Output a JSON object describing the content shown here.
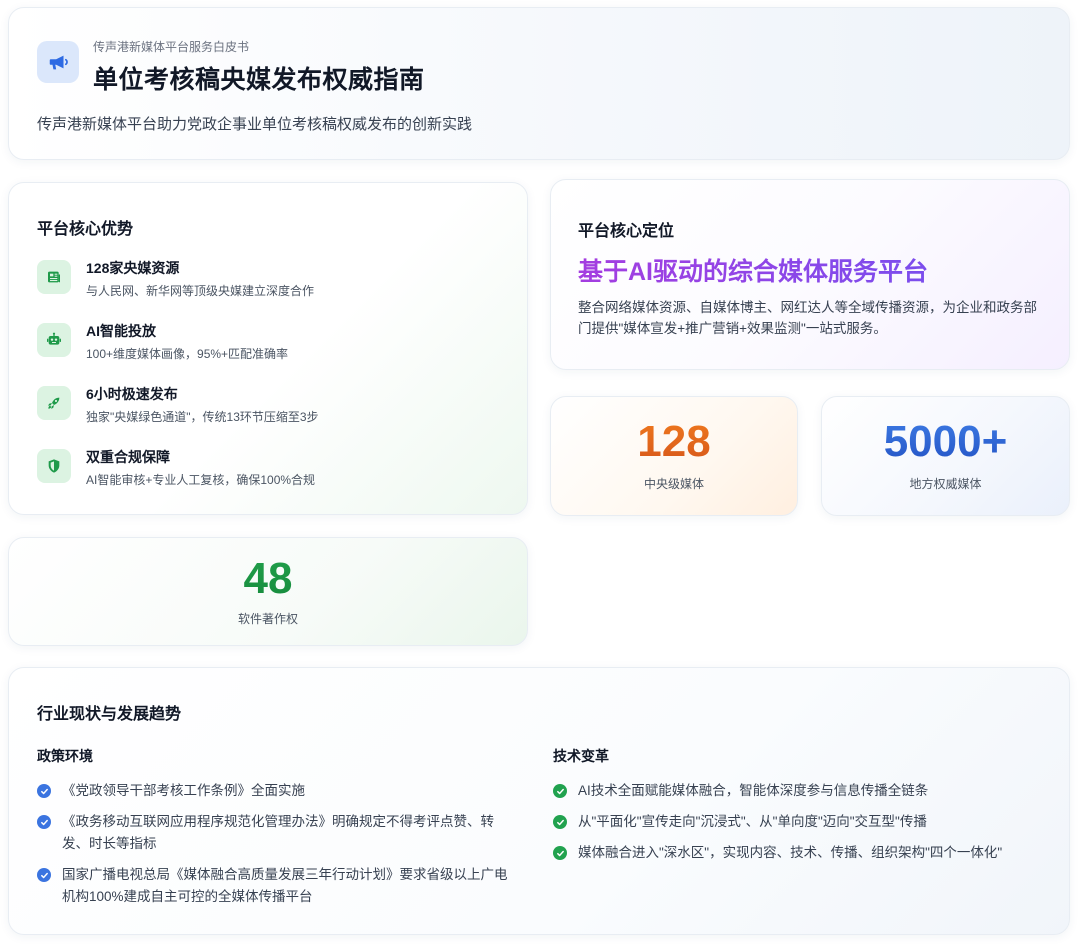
{
  "header": {
    "eyebrow": "传声港新媒体平台服务白皮书",
    "title": "单位考核稿央媒发布权威指南",
    "subtitle": "传声港新媒体平台助力党政企事业单位考核稿权威发布的创新实践",
    "icon": "megaphone-icon"
  },
  "advantages": {
    "title": "平台核心优势",
    "items": [
      {
        "icon": "newspaper-icon",
        "title": "128家央媒资源",
        "desc": "与人民网、新华网等顶级央媒建立深度合作"
      },
      {
        "icon": "robot-icon",
        "title": "AI智能投放",
        "desc": "100+维度媒体画像，95%+匹配准确率"
      },
      {
        "icon": "rocket-icon",
        "title": "6小时极速发布",
        "desc": "独家\"央媒绿色通道\"，传统13环节压缩至3步"
      },
      {
        "icon": "shield-icon",
        "title": "双重合规保障",
        "desc": "AI智能审核+专业人工复核，确保100%合规"
      }
    ]
  },
  "positioning": {
    "title": "平台核心定位",
    "slogan": "基于AI驱动的综合媒体服务平台",
    "desc": "整合网络媒体资源、自媒体博主、网红达人等全域传播资源，为企业和政务部门提供\"媒体宣发+推广营销+效果监测\"一站式服务。"
  },
  "stats": {
    "central": {
      "value": "128",
      "label": "中央级媒体",
      "color": "#e26217"
    },
    "local": {
      "value": "5000+",
      "label": "地方权威媒体",
      "color": "#2f63d2"
    },
    "software": {
      "value": "48",
      "label": "软件著作权",
      "color": "#1c9445"
    }
  },
  "trends": {
    "title": "行业现状与发展趋势",
    "policy": {
      "title": "政策环境",
      "color": "#3b74e0",
      "items": [
        "《党政领导干部考核工作条例》全面实施",
        "《政务移动互联网应用程序规范化管理办法》明确规定不得考评点赞、转发、时长等指标",
        "国家广播电视总局《媒体融合高质量发展三年行动计划》要求省级以上广电机构100%建成自主可控的全媒体传播平台"
      ]
    },
    "tech": {
      "title": "技术变革",
      "color": "#21a24f",
      "items": [
        "AI技术全面赋能媒体融合，智能体深度参与信息传播全链条",
        "从\"平面化\"宣传走向\"沉浸式\"、从\"单向度\"迈向\"交互型\"传播",
        "媒体融合进入\"深水区\"，实现内容、技术、传播、组织架构\"四个一体化\""
      ]
    }
  }
}
